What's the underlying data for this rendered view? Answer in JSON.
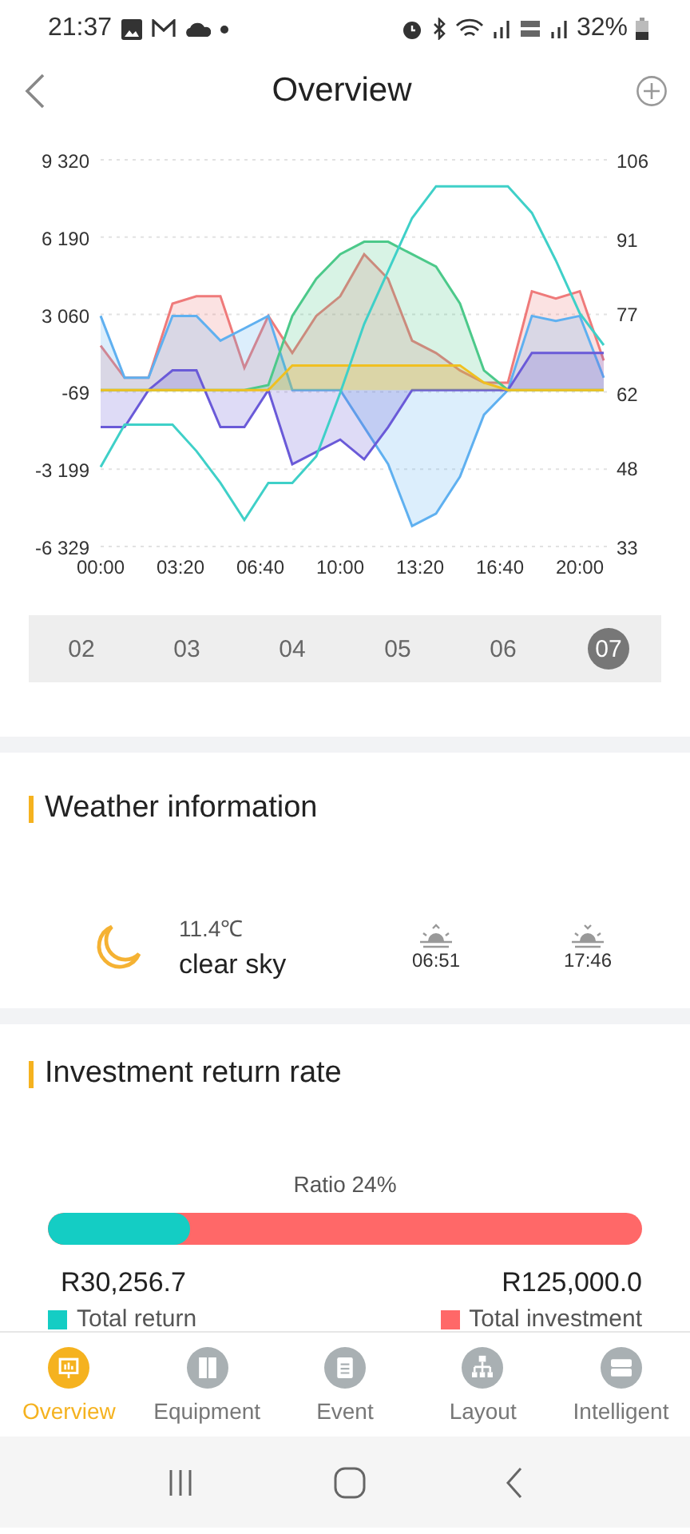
{
  "status_bar": {
    "time": "21:37",
    "battery": "32%"
  },
  "header": {
    "title": "Overview"
  },
  "chart": {
    "chart_data": {
      "type": "area",
      "x": [
        0,
        60,
        120,
        180,
        240,
        300,
        360,
        420,
        480,
        540,
        600,
        660,
        720,
        780,
        840,
        900,
        960,
        1020,
        1080,
        1140,
        1200,
        1260
      ],
      "xlim": [
        0,
        1272
      ],
      "xticks": [
        {
          "value": 0,
          "label": "00:00"
        },
        {
          "value": 200,
          "label": "03:20"
        },
        {
          "value": 400,
          "label": "06:40"
        },
        {
          "value": 600,
          "label": "10:00"
        },
        {
          "value": 800,
          "label": "13:20"
        },
        {
          "value": 1000,
          "label": "16:40"
        },
        {
          "value": 1200,
          "label": "20:00"
        }
      ],
      "grid": true,
      "ylim": [
        -6329,
        9320
      ],
      "y2lim": [
        33,
        106
      ],
      "yticks": [
        {
          "value": 9320,
          "label": "9 320"
        },
        {
          "value": 6190,
          "label": "6 190"
        },
        {
          "value": 3060,
          "label": "3 060"
        },
        {
          "value": -69,
          "label": "-69"
        },
        {
          "value": -3199,
          "label": "-3 199"
        },
        {
          "value": -6329,
          "label": "-6 329"
        }
      ],
      "y2ticks": [
        106,
        91,
        77,
        62,
        48,
        33
      ],
      "series": [
        {
          "color": "#ef7a7a",
          "values": [
            1800,
            500,
            500,
            3500,
            3800,
            3800,
            900,
            3000,
            1500,
            3000,
            3800,
            5500,
            4500,
            2000,
            1500,
            800,
            300,
            300,
            4000,
            3700,
            4000,
            1200
          ]
        },
        {
          "color": "#5fb0f0",
          "values": [
            3000,
            500,
            500,
            3000,
            3000,
            2000,
            2500,
            3000,
            0,
            0,
            0,
            -1500,
            -3000,
            -5500,
            -5000,
            -3500,
            -1000,
            0,
            3000,
            2800,
            3000,
            500
          ]
        },
        {
          "color": "#6a5ad8",
          "values": [
            -1500,
            -1500,
            0,
            800,
            800,
            -1500,
            -1500,
            0,
            -3000,
            -2500,
            -2000,
            -2800,
            -1500,
            0,
            0,
            0,
            0,
            0,
            1500,
            1500,
            1500,
            1500
          ]
        },
        {
          "color": "#4cc98a",
          "values": [
            0,
            0,
            0,
            0,
            0,
            0,
            0,
            200,
            3000,
            4500,
            5500,
            6000,
            6000,
            5500,
            5000,
            3500,
            800,
            0,
            0,
            0,
            0,
            0
          ]
        },
        {
          "color": "#f0c020",
          "values": [
            0,
            0,
            0,
            0,
            0,
            0,
            0,
            0,
            1000,
            1000,
            1000,
            1000,
            1000,
            1000,
            1000,
            1000,
            300,
            0,
            0,
            0,
            0,
            0
          ]
        },
        {
          "color": "#3fd0c8",
          "axis": "y2",
          "type": "line",
          "values": [
            48,
            56,
            56,
            56,
            51,
            45,
            38,
            45,
            45,
            50,
            62,
            75,
            85,
            95,
            101,
            101,
            101,
            101,
            96,
            87,
            77,
            71
          ]
        }
      ]
    }
  },
  "days": [
    {
      "label": "02",
      "selected": false
    },
    {
      "label": "03",
      "selected": false
    },
    {
      "label": "04",
      "selected": false
    },
    {
      "label": "05",
      "selected": false
    },
    {
      "label": "06",
      "selected": false
    },
    {
      "label": "07",
      "selected": true
    }
  ],
  "weather": {
    "title": "Weather information",
    "temperature": "11.4℃",
    "condition": "clear sky",
    "sunrise": "06:51",
    "sunset": "17:46"
  },
  "investment": {
    "title": "Investment return rate",
    "ratio": "Ratio 24%",
    "level": 0.24,
    "return_value": "R30,256.7",
    "investment_value": "R125,000.0",
    "legend": [
      {
        "label": "Total return",
        "color": "#14cdc4"
      },
      {
        "label": "Total investment",
        "color": "#ff6868"
      }
    ]
  },
  "tabs": [
    {
      "label": "Overview",
      "kind": "overview",
      "selected": true
    },
    {
      "label": "Equipment",
      "kind": "equipment",
      "selected": false
    },
    {
      "label": "Event",
      "kind": "event",
      "selected": false
    },
    {
      "label": "Layout",
      "kind": "layout",
      "selected": false
    },
    {
      "label": "Intelligent",
      "kind": "intelligent",
      "selected": false
    }
  ]
}
